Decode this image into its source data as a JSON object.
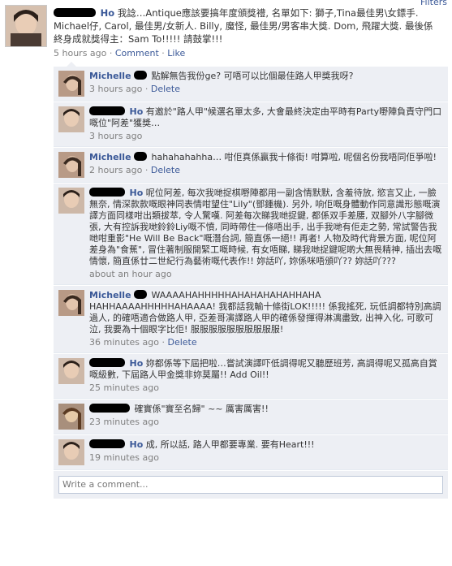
{
  "filters_label": "Filters",
  "post": {
    "author": "Ho",
    "text": "我諗…Antique應該要搞年度頒獎禮, 名單如下: 獅子,Tina最佳男\\女鏢手. Michael仔, Carol, 最佳男/女新人. Billy, 魔怪, 最佳男/男客串大獎. Dom, 飛躍大獎. 最後係終身成就獎得主：Sam To!!!!! 請鼓掌!!!",
    "time": "5 hours ago",
    "comment_label": "Comment",
    "like_label": "Like"
  },
  "comments": [
    {
      "author": "Michelle",
      "text": "點解無告我份ge? 可唔可以比個最佳路人甲獎我呀?",
      "time": "3 hours ago",
      "delete_label": "Delete"
    },
    {
      "author": "Ho",
      "text": "有邀於\"路人甲\"候選名單太多, 大會最終決定由平時有Party嘢陣負責守門口嘅位\"阿差\"獲獎…",
      "time": "3 hours ago",
      "delete_label": ""
    },
    {
      "author": "Michelle",
      "text": "hahahahahha… 咁佢真係贏我十條街! 咁算啦, 呢個名份我唔同佢爭啦!",
      "time": "2 hours ago",
      "delete_label": "Delete"
    },
    {
      "author": "Ho",
      "text": "呢位阿差, 每次我哋捉棋嘢陣都用一副含情默默, 含羞待放, 慾言又止, 一臉無奈, 情深款款嘅眼神同表情咁望住\"Lily\"(鄧鍾機). 另外, 响佢嘅身體動作同意識形態嘅演譯方面同樣咁出類拔萃, 令人驚嘆. 阿差每次睇我哋捉鍵, 都係双手差腰, 双腳外八字腳微張, 大有控訴我哋鈴鈴Liy嘅不憤, 同時帶住一條唔出手, 出手我哋有佢走之勢, 常試警告我哋咁重影\"He Will Be Back\"嘅潛台詞, 簡直係一絕!! 再者! 人物及時代背景方面, 呢位阿差身為\"食蕉\", 冒住著制服開緊工嘅時候, 有女唔睇, 睇我哋捉鍵呢啲大無畏精神, 插出去嘅情懷, 簡直係廿二世紀行為藝術嘅代表作!! 妳話吖, 妳係咪唔頒吖?? 妳話吖???",
      "time": "about an hour ago",
      "delete_label": ""
    },
    {
      "author": "Michelle",
      "text": "WAAAAHAHHHHHAHAHAHAHAHHAHA HAHHAAAAHHHHHAHAAAA! 我都話我輸十條街LOK!!!!! 係我搖死, 玩低調都特別高調過人, 的確唔適合做路人甲, 亞差哥演譯路人甲的確係發揮得淋漓盡致, 出神入化, 可歌可泣, 我要為十個眼字比佢! 服服服服服服服服服服!",
      "time": "36 minutes ago",
      "delete_label": "Delete"
    },
    {
      "author": "Ho",
      "text": "妳都係等下屆把啦…嘗試演譯吓低調得呢又聽歷班芳, 高調得呢又孤高自賞嘅級數, 下屆路人甲金獎非妳莫屬!! Add Oil!!",
      "time": "25 minutes ago",
      "delete_label": ""
    },
    {
      "author": "",
      "text": "確實係\"實至名歸\" ~~ 厲害厲害!!",
      "time": "23 minutes ago",
      "delete_label": ""
    },
    {
      "author": "Ho",
      "text": "成, 所以話, 路人甲都要專業. 要有Heart!!!",
      "time": "19 minutes ago",
      "delete_label": ""
    }
  ],
  "write_placeholder": "Write a comment..."
}
